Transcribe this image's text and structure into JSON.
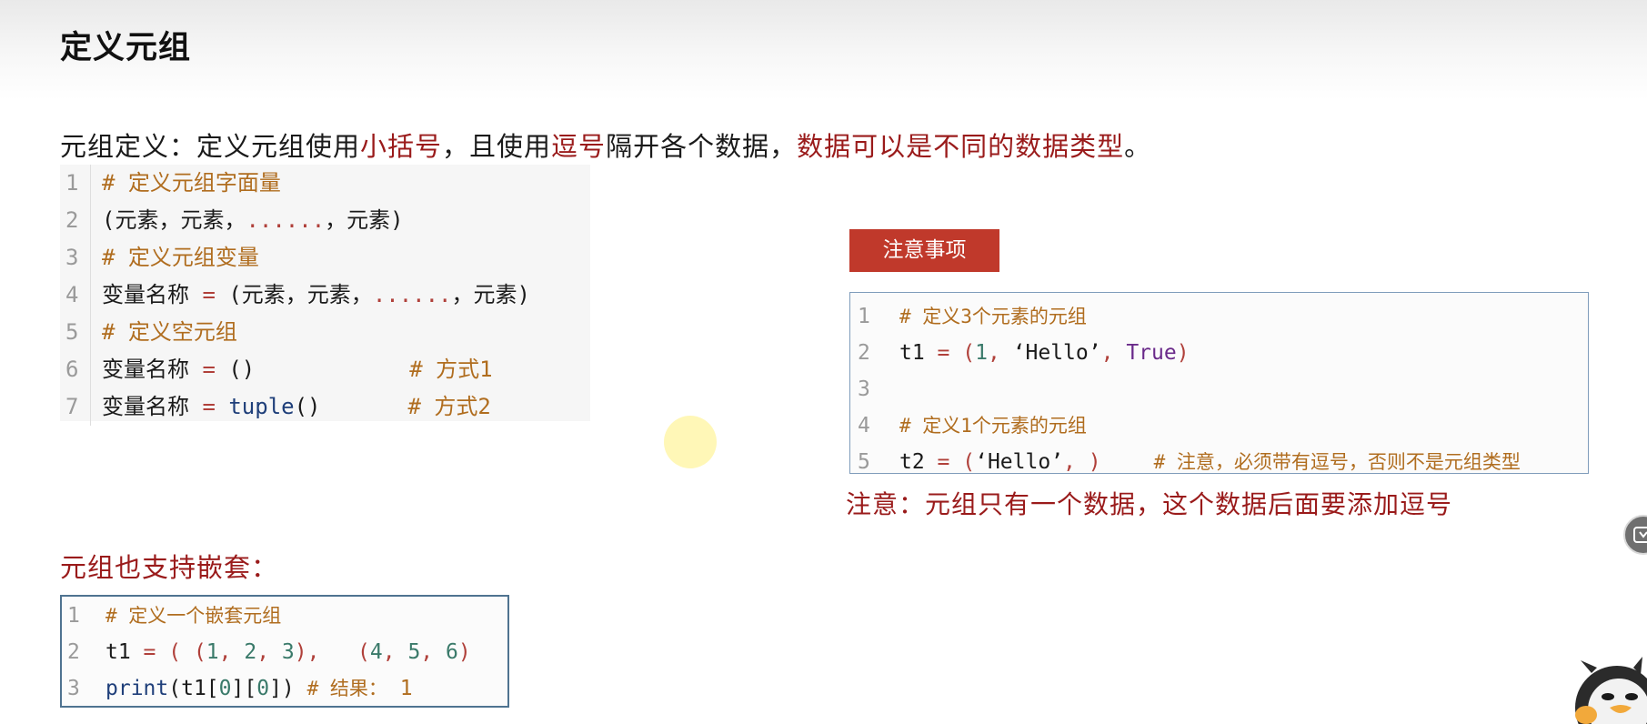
{
  "header": {
    "title": "定义元组"
  },
  "intro": {
    "p1": "元组定义：定义元组使用",
    "h1": "小括号",
    "p2": "，且使用",
    "h2": "逗号",
    "p3": "隔开各个数据，",
    "h3": "数据可以是不同的数据类型",
    "p4": "。"
  },
  "code_left": {
    "lines": [
      {
        "n": "1",
        "comment": "# 定义元组字面量"
      },
      {
        "n": "2",
        "a": "(元素，元素，",
        "dots": "......",
        "b": "，元素)"
      },
      {
        "n": "3",
        "comment": "# 定义元组变量"
      },
      {
        "n": "4",
        "var": "变量名称",
        "eq": " = ",
        "a": "(元素，元素，",
        "dots": "......",
        "b": "，元素)"
      },
      {
        "n": "5",
        "comment": "# 定义空元组"
      },
      {
        "n": "6",
        "var": "变量名称",
        "eq": " = ",
        "a": "()",
        "comment": "# 方式1"
      },
      {
        "n": "7",
        "var": "变量名称",
        "eq": " = ",
        "fn": "tuple",
        "a": "()",
        "comment": "# 方式2"
      }
    ]
  },
  "notice": {
    "label": "注意事项"
  },
  "code_right": {
    "lines": [
      {
        "n": "1",
        "comment": "# 定义3个元素的元组"
      },
      {
        "n": "2",
        "var": "t1",
        "eq": " = ",
        "open": "(",
        "num": "1",
        "sep1": ", ",
        "str": "‘Hello’",
        "sep2": ", ",
        "kw": "True",
        "close": ")"
      },
      {
        "n": "3"
      },
      {
        "n": "4",
        "comment": "# 定义1个元素的元组"
      },
      {
        "n": "5",
        "var": "t2",
        "eq": " = ",
        "open": "(",
        "str": "‘Hello’",
        "sep": ", )",
        "comment": "# 注意，必须带有逗号，否则不是元组类型"
      }
    ]
  },
  "note": "注意：元组只有一个数据，这个数据后面要添加逗号",
  "nest": {
    "title": "元组也支持嵌套：",
    "lines": [
      {
        "n": "1",
        "comment": "# 定义一个嵌套元组"
      },
      {
        "n": "2",
        "var": "t1",
        "eq": " = ",
        "open": "( (",
        "n1": "1",
        "s1": ", ",
        "n2": "2",
        "s2": ", ",
        "n3": "3",
        "mid": "),   (",
        "n4": "4",
        "s3": ", ",
        "n5": "5",
        "s4": ", ",
        "n6": "6",
        "close": ")"
      },
      {
        "n": "3",
        "fn": "print",
        "a": "(t1[",
        "i1": "0",
        "b": "][",
        "i2": "0",
        "c": "])",
        "comment": "# 结果：",
        "res": "1"
      }
    ]
  },
  "colors": {
    "accent_red": "#9a1b1b",
    "notice_bg": "#c0392b",
    "comment": "#b06d1f",
    "code_border": "#7f9cbb"
  },
  "icons": {
    "side_button": "collapse-icon",
    "mascot": "penguin-mascot-icon"
  }
}
